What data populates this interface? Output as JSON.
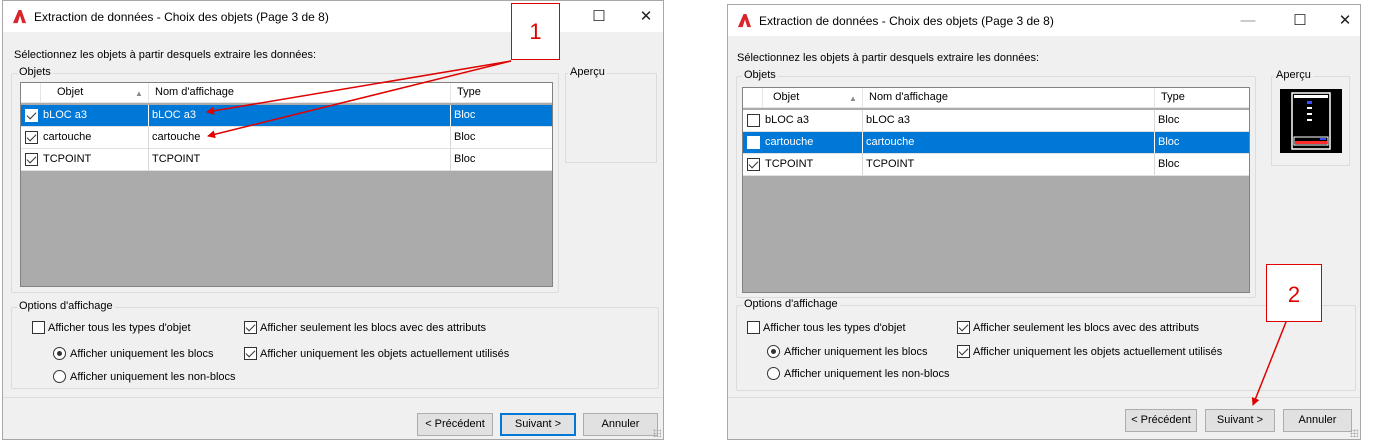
{
  "dialogs": [
    {
      "title": "Extraction de données - Choix des objets (Page 3 de 8)",
      "instruction": "Sélectionnez les objets à partir desquels extraire les données:",
      "objects_group": "Objets",
      "preview_label": "Aperçu",
      "columns": [
        "Objet",
        "Nom d'affichage",
        "Type"
      ],
      "rows": [
        {
          "objet": "bLOC a3",
          "nom": "bLOC a3",
          "type": "Bloc",
          "checked": true,
          "selected": true
        },
        {
          "objet": "cartouche",
          "nom": "cartouche",
          "type": "Bloc",
          "checked": true,
          "selected": false
        },
        {
          "objet": "TCPOINT",
          "nom": "TCPOINT",
          "type": "Bloc",
          "checked": true,
          "selected": false
        }
      ],
      "display_options": {
        "label": "Options d'affichage",
        "show_all_types": "Afficher tous les types d'objet",
        "blocks_only": "Afficher uniquement les blocs",
        "non_blocks_only": "Afficher uniquement les non-blocs",
        "blocks_with_attributes": "Afficher seulement les  blocs avec des attributs",
        "objects_in_use": "Afficher uniquement les objets actuellement utilisés"
      },
      "buttons": {
        "back": "< Précédent",
        "next": "Suivant >",
        "cancel": "Annuler"
      },
      "callout": "1"
    },
    {
      "title": "Extraction de données - Choix des objets (Page 3 de 8)",
      "instruction": "Sélectionnez les objets à partir desquels extraire les données:",
      "objects_group": "Objets",
      "preview_label": "Aperçu",
      "columns": [
        "Objet",
        "Nom d'affichage",
        "Type"
      ],
      "rows": [
        {
          "objet": "bLOC a3",
          "nom": "bLOC a3",
          "type": "Bloc",
          "checked": false,
          "selected": false
        },
        {
          "objet": "cartouche",
          "nom": "cartouche",
          "type": "Bloc",
          "checked": false,
          "selected": true
        },
        {
          "objet": "TCPOINT",
          "nom": "TCPOINT",
          "type": "Bloc",
          "checked": true,
          "selected": false
        }
      ],
      "display_options": {
        "label": "Options d'affichage",
        "show_all_types": "Afficher tous les types d'objet",
        "blocks_only": "Afficher uniquement les blocs",
        "non_blocks_only": "Afficher uniquement les non-blocs",
        "blocks_with_attributes": "Afficher seulement les  blocs avec des attributs",
        "objects_in_use": "Afficher uniquement les objets actuellement utilisés"
      },
      "buttons": {
        "back": "< Précédent",
        "next": "Suivant >",
        "cancel": "Annuler"
      },
      "callout": "2"
    }
  ],
  "window_controls": {
    "minimize": "—",
    "maximize": "☐",
    "close": "✕"
  },
  "colors": {
    "selection": "#0078d7",
    "annotation": "#e00000",
    "app_icon": "#d8262c"
  }
}
